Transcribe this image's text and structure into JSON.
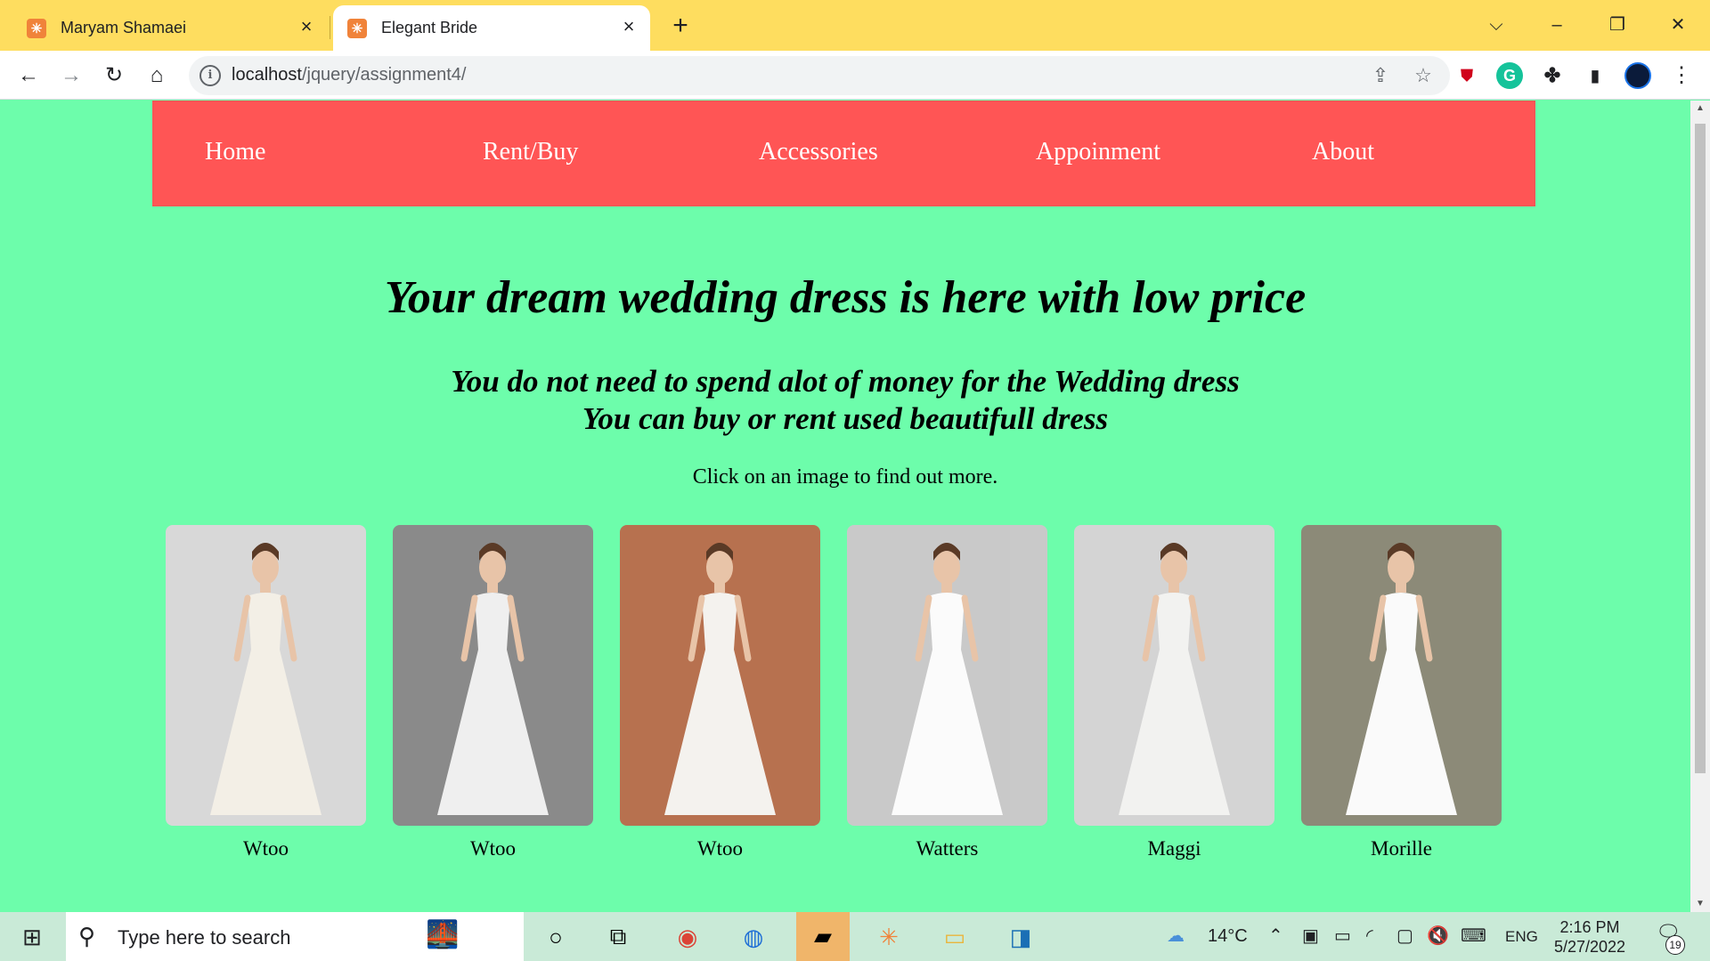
{
  "browser": {
    "tabs": [
      {
        "title": "Maryam Shamaei",
        "active": false
      },
      {
        "title": "Elegant Bride",
        "active": true
      }
    ],
    "url_host": "localhost",
    "url_path": "/jquery/assignment4/"
  },
  "nav": {
    "items": [
      "Home",
      "Rent/Buy",
      "Accessories",
      "Appoinment",
      "About"
    ]
  },
  "hero": {
    "headline": "Your dream wedding dress is here with low price",
    "sub_line1": "You do not need to spend alot of money for the Wedding dress",
    "sub_line2": "You can buy or rent used beautifull dress",
    "hint": "Click on an image to find out more."
  },
  "dresses": [
    {
      "name": "Wtoo",
      "bg": "#d8d8d8",
      "dress": "#f3efe6"
    },
    {
      "name": "Wtoo",
      "bg": "#8a8a8a",
      "dress": "#efefef"
    },
    {
      "name": "Wtoo",
      "bg": "#b7714f",
      "dress": "#f4f2ee"
    },
    {
      "name": "Watters",
      "bg": "#c9c9c9",
      "dress": "#fbfbfb"
    },
    {
      "name": "Maggi",
      "bg": "#d4d4d4",
      "dress": "#f2f2f0"
    },
    {
      "name": "Morille",
      "bg": "#8c8a78",
      "dress": "#fafafa"
    }
  ],
  "taskbar": {
    "search_placeholder": "Type here to search",
    "temperature": "14°C",
    "language": "ENG",
    "time": "2:16 PM",
    "date": "5/27/2022",
    "notifications": "19"
  },
  "colors": {
    "page_bg": "#6dfdab",
    "nav_bg": "#ff5555",
    "tabstrip_bg": "#fedd5f"
  }
}
